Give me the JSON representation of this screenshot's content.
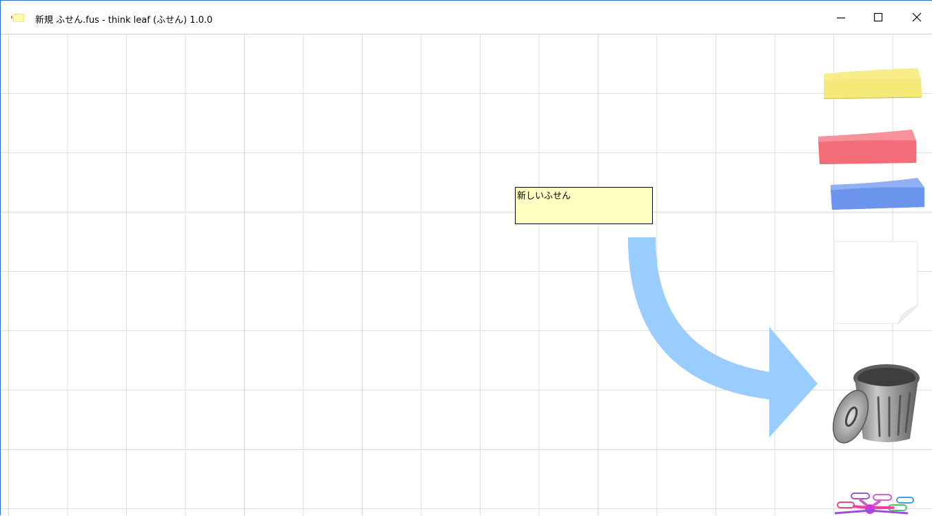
{
  "window": {
    "title": "新規 ふせん.fus - think leaf (ふせん) 1.0.0",
    "controls": {
      "minimize_icon": "minimize-icon",
      "maximize_icon": "maximize-icon",
      "close_icon": "close-icon"
    }
  },
  "canvas": {
    "grid_color": "#dcdce4",
    "notes": [
      {
        "text": "新しいふせん",
        "color": "#ffffc2"
      }
    ],
    "arrow_color": "#99ccff"
  },
  "palette": {
    "items": [
      {
        "name": "yellow-sticky-pad-icon",
        "color": "#f5e97a"
      },
      {
        "name": "red-sticky-pad-icon",
        "color": "#f26d78"
      },
      {
        "name": "blue-sticky-pad-icon",
        "color": "#6b94ec"
      },
      {
        "name": "blank-paper-icon",
        "color": "#ffffff"
      },
      {
        "name": "trash-can-icon",
        "color": "#8a8a8a"
      },
      {
        "name": "mind-map-icon",
        "color": "#d05fd0"
      }
    ]
  }
}
